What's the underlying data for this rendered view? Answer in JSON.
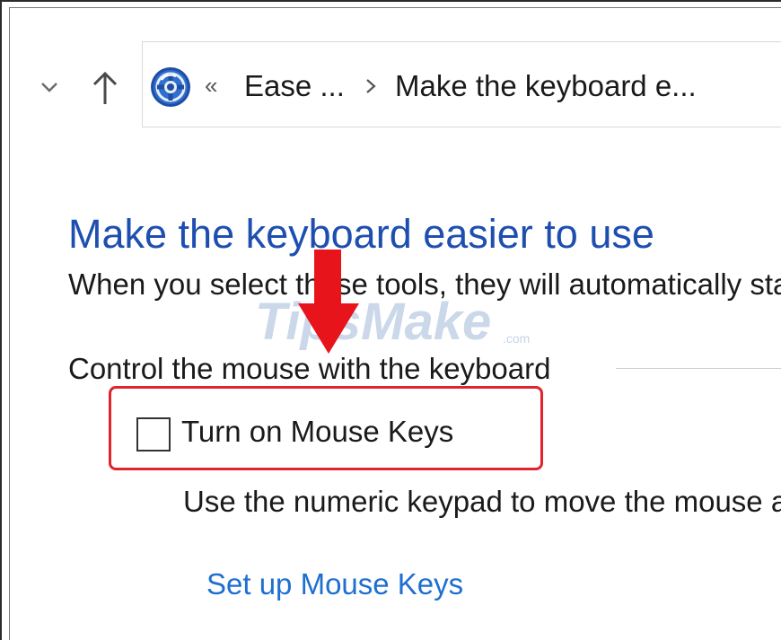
{
  "breadcrumb": {
    "overflow_glyph": "«",
    "items": [
      "Ease ...",
      "Make the keyboard e..."
    ]
  },
  "page": {
    "title": "Make the keyboard easier to use",
    "description": "When you select these tools, they will automatically start each time you sign in."
  },
  "section": {
    "header": "Control the mouse with the keyboard",
    "checkbox_label": "Turn on Mouse Keys",
    "checkbox_checked": false,
    "helper_text": "Use the numeric keypad to move the mouse around the screen.",
    "link_label": "Set up Mouse Keys"
  },
  "annotation": {
    "highlight_color": "#e0242e",
    "arrow_color": "#e8141c"
  },
  "watermark": {
    "text": "TipsMake",
    "suffix": ".com"
  },
  "colors": {
    "title_blue": "#1e4fb0",
    "link_blue": "#1f6fd0"
  }
}
